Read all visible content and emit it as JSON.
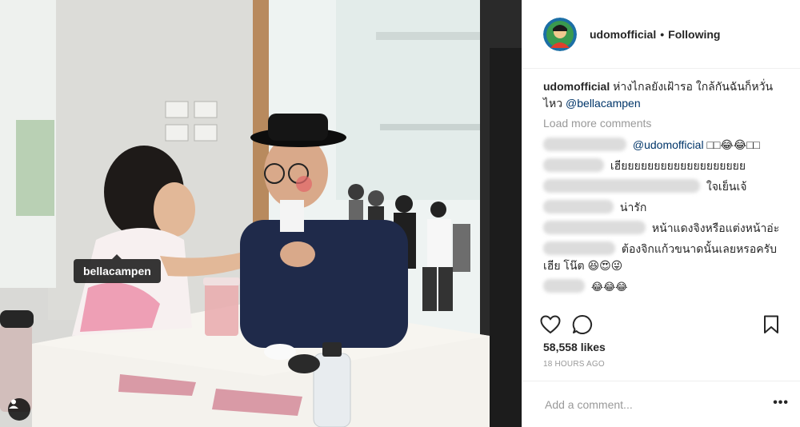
{
  "post": {
    "author": "udomofficial",
    "separator": "•",
    "follow_status": "Following",
    "caption_text": "ห่างไกลยังเฝ้ารอ ใกล้กันฉันก็หวั่นไหว",
    "caption_mention": "@bellacampen",
    "load_more": "Load more comments",
    "photo_tag": "bellacampen",
    "likes": "58,558 likes",
    "timestamp": "18 HOURS AGO",
    "add_comment_placeholder": "Add a comment...",
    "more_label": "•••"
  },
  "comments": [
    {
      "mention": "@udomofficial",
      "text": " □□😂😂□□"
    },
    {
      "mention": "",
      "text": "เฮียยยยยยยยยยยยยยยยยยย"
    },
    {
      "mention": "",
      "text": "ใจเย็นเจ้"
    },
    {
      "mention": "",
      "text": "น่ารัก"
    },
    {
      "mention": "",
      "text": "หน้าแดงจิงหรือแต่งหน้าอ่ะ"
    },
    {
      "mention": "",
      "text": "ต้องจิกแก้วขนาดนั้นเลยหรอครับเฮีย โน๊ต 😆😍😜"
    },
    {
      "mention": "",
      "text": "😂😂😂"
    }
  ],
  "icons": {
    "like": "heart-icon",
    "comment": "comment-icon",
    "save": "bookmark-icon",
    "tags": "person-tag-icon"
  }
}
